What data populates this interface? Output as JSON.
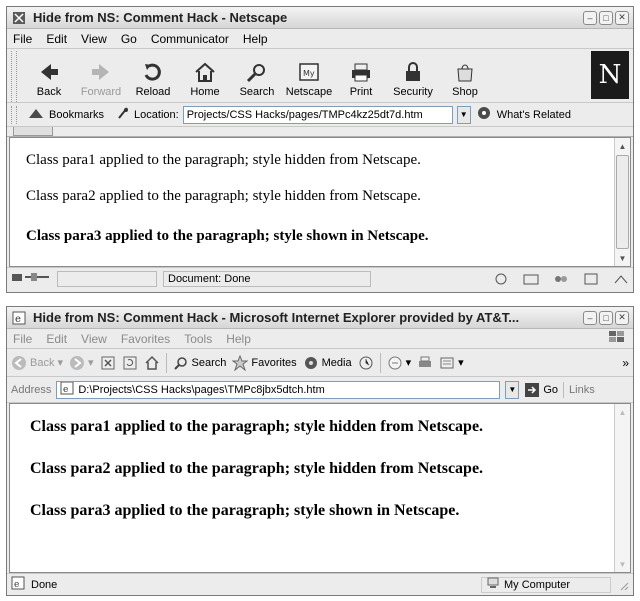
{
  "netscape": {
    "title": "Hide from NS: Comment Hack - Netscape",
    "menu": [
      "File",
      "Edit",
      "View",
      "Go",
      "Communicator",
      "Help"
    ],
    "toolbar": [
      "Back",
      "Forward",
      "Reload",
      "Home",
      "Search",
      "Netscape",
      "Print",
      "Security",
      "Shop"
    ],
    "logo": "N",
    "bookmarks_label": "Bookmarks",
    "location_label": "Location:",
    "location_url": "Projects/CSS Hacks/pages/TMPc4kz25dt7d.htm",
    "related_label": "What's Related",
    "paragraphs": [
      "Class para1 applied to the paragraph; style hidden from Netscape.",
      "Class para2 applied to the paragraph; style hidden from Netscape.",
      "Class para3 applied to the paragraph; style shown in Netscape."
    ],
    "status": "Document: Done"
  },
  "ie": {
    "title": "Hide from NS: Comment Hack - Microsoft Internet Explorer provided by AT&T...",
    "menu": [
      "File",
      "Edit",
      "View",
      "Favorites",
      "Tools",
      "Help"
    ],
    "toolbar": {
      "back": "Back",
      "search": "Search",
      "favorites": "Favorites",
      "media": "Media"
    },
    "address_label": "Address",
    "address_url": "D:\\Projects\\CSS Hacks\\pages\\TMPc8jbx5dtch.htm",
    "go_label": "Go",
    "links_label": "Links",
    "paragraphs": [
      "Class para1 applied to the paragraph; style hidden from Netscape.",
      "Class para2 applied to the paragraph; style hidden from Netscape.",
      "Class para3 applied to the paragraph; style shown in Netscape."
    ],
    "status": "Done",
    "zone": "My Computer"
  }
}
